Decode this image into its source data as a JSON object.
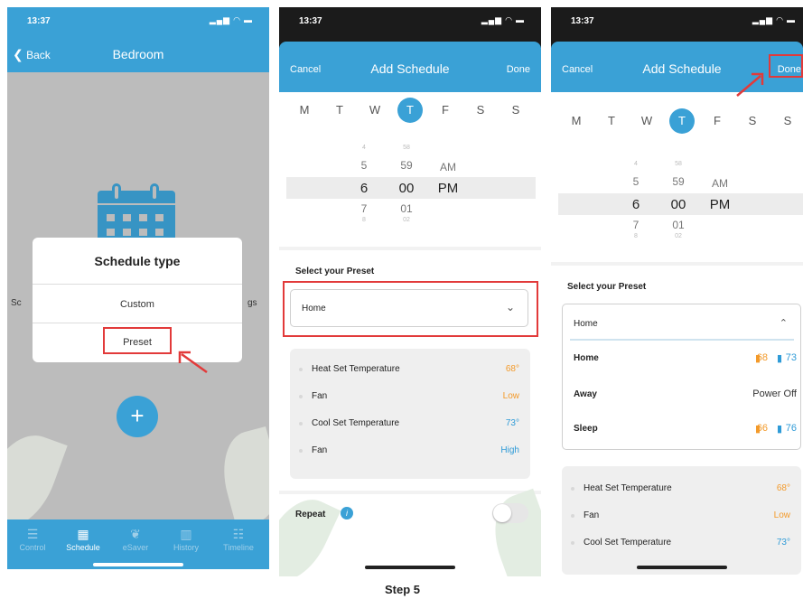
{
  "step_label": "Step 5",
  "status": {
    "time": "13:37",
    "icons": "signal-wifi-battery"
  },
  "screen1": {
    "back_label": "Back",
    "title": "Bedroom",
    "side_left": "Sc",
    "side_right": "gs",
    "dialog": {
      "title": "Schedule type",
      "option_custom": "Custom",
      "option_preset": "Preset"
    },
    "fab_label": "+",
    "tabs": [
      {
        "label": "Control",
        "icon": "sliders-icon"
      },
      {
        "label": "Schedule",
        "icon": "calendar-icon"
      },
      {
        "label": "eSaver",
        "icon": "leaf-icon"
      },
      {
        "label": "History",
        "icon": "bar-chart-icon"
      },
      {
        "label": "Timeline",
        "icon": "timeline-icon"
      }
    ]
  },
  "screen2": {
    "cancel": "Cancel",
    "title": "Add Schedule",
    "done": "Done",
    "days": [
      "M",
      "T",
      "W",
      "T",
      "F",
      "S",
      "S"
    ],
    "selected_day_index": 3,
    "picker": {
      "hours": [
        "4",
        "5",
        "6",
        "7",
        "8"
      ],
      "minutes": [
        "58",
        "59",
        "00",
        "01",
        "02"
      ],
      "ampm": [
        "AM",
        "PM"
      ]
    },
    "select_label": "Select your Preset",
    "select_value": "Home",
    "settings": [
      {
        "name": "Heat Set Temperature",
        "value": "68°",
        "color": "#f39a2a"
      },
      {
        "name": "Fan",
        "value": "Low",
        "color": "#f39a2a"
      },
      {
        "name": "Cool Set Temperature",
        "value": "73°",
        "color": "#2f9bd7"
      },
      {
        "name": "Fan",
        "value": "High",
        "color": "#2f9bd7"
      }
    ],
    "repeat_label": "Repeat",
    "repeat_info": "i"
  },
  "screen3": {
    "cancel": "Cancel",
    "title": "Add Schedule",
    "done": "Done",
    "days": [
      "M",
      "T",
      "W",
      "T",
      "F",
      "S",
      "S"
    ],
    "selected_day_index": 3,
    "picker": {
      "hours": [
        "4",
        "5",
        "6",
        "7",
        "8"
      ],
      "minutes": [
        "58",
        "59",
        "00",
        "01",
        "02"
      ],
      "ampm": [
        "AM",
        "PM"
      ]
    },
    "select_label": "Select your Preset",
    "select_value": "Home",
    "presets": [
      {
        "name": "Home",
        "heat": "68",
        "cool": "73"
      },
      {
        "name": "Away",
        "text": "Power Off"
      },
      {
        "name": "Sleep",
        "heat": "66",
        "cool": "76"
      }
    ],
    "settings": [
      {
        "name": "Heat Set Temperature",
        "value": "68°",
        "color": "#f39a2a"
      },
      {
        "name": "Fan",
        "value": "Low",
        "color": "#f39a2a"
      },
      {
        "name": "Cool Set Temperature",
        "value": "73°",
        "color": "#2f9bd7"
      }
    ]
  },
  "colors": {
    "brand_blue": "#3aa1d6",
    "highlight_red": "#e23a3a",
    "heat_orange": "#f39a2a",
    "cool_blue": "#2f9bd7"
  }
}
